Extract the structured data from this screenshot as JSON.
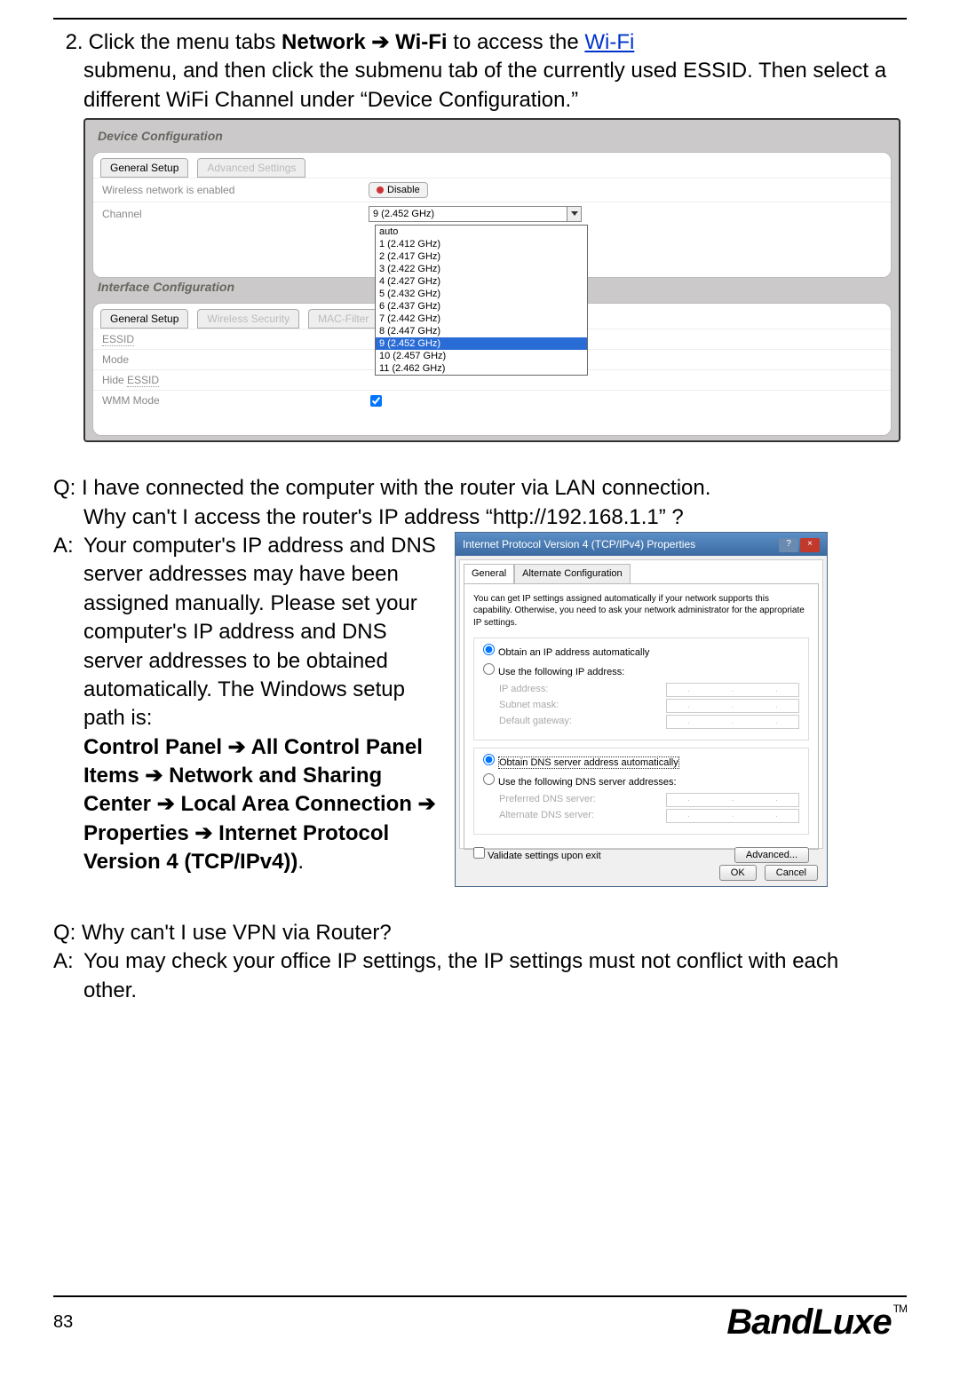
{
  "instruction": {
    "number": "2.",
    "text_before_bold": "Click the menu tabs ",
    "bold1": "Network ",
    "arrow": "➔",
    "bold2": " Wi-Fi",
    "text_mid": " to access the ",
    "link": "Wi-Fi",
    "cont": " submenu, and then click the submenu tab of the currently used ESSID. Then select a different WiFi Channel under “Device Configuration.”"
  },
  "router": {
    "section1_title": "Device Configuration",
    "tab_general": "General Setup",
    "tab_advanced": "Advanced Settings",
    "row_wireless": "Wireless network is enabled",
    "btn_disable": "Disable",
    "row_channel": "Channel",
    "channel_selected": "9 (2.452 GHz)",
    "channel_list": [
      "auto",
      "1 (2.412 GHz)",
      "2 (2.417 GHz)",
      "3 (2.422 GHz)",
      "4 (2.427 GHz)",
      "5 (2.432 GHz)",
      "6 (2.437 GHz)",
      "7 (2.442 GHz)",
      "8 (2.447 GHz)",
      "9 (2.452 GHz)",
      "10 (2.457 GHz)",
      "11 (2.462 GHz)"
    ],
    "section2_title": "Interface Configuration",
    "tab2_general": "General Setup",
    "tab2_wireless": "Wireless Security",
    "tab2_mac": "MAC-Filter",
    "row_essid": "ESSID",
    "row_mode": "Mode",
    "row_hide": "Hide ESSID",
    "row_wmm": "WMM Mode"
  },
  "qa1": {
    "q_prefix": "Q:",
    "q_line1": " I have connected the computer with the router via LAN connection.",
    "q_line2": "Why can't I access the router's IP address “http://192.168.1.1” ?",
    "a_prefix": "A:",
    "a_body": "Your computer's IP address and DNS server addresses may have been assigned manually. Please set your computer's IP address and DNS server addresses to be obtained automatically. The Windows setup path is:",
    "a_bold": "Control Panel ➔ All Control Panel Items ➔ Network and Sharing Center ➔ Local Area Connection ➔ Properties ➔ Internet Protocol Version 4 (TCP/IPv4))",
    "a_period": "."
  },
  "windlg": {
    "title": "Internet Protocol Version 4 (TCP/IPv4) Properties",
    "tab_general": "General",
    "tab_alt": "Alternate Configuration",
    "desc": "You can get IP settings assigned automatically if your network supports this capability. Otherwise, you need to ask your network administrator for the appropriate IP settings.",
    "r1": "Obtain an IP address automatically",
    "r2": "Use the following IP address:",
    "f_ip": "IP address:",
    "f_mask": "Subnet mask:",
    "f_gw": "Default gateway:",
    "r3": "Obtain DNS server address automatically",
    "r4": "Use the following DNS server addresses:",
    "f_dns1": "Preferred DNS server:",
    "f_dns2": "Alternate DNS server:",
    "validate": "Validate settings upon exit",
    "advanced": "Advanced...",
    "ok": "OK",
    "cancel": "Cancel"
  },
  "qa2": {
    "q_prefix": "Q:",
    "q_text": " Why can't I use VPN via Router?",
    "a_prefix": "A:",
    "a_text": "You may check your office IP settings, the IP settings must not conflict with each other."
  },
  "footer": {
    "page": "83",
    "brand": "BandLuxe",
    "tm": "TM"
  }
}
